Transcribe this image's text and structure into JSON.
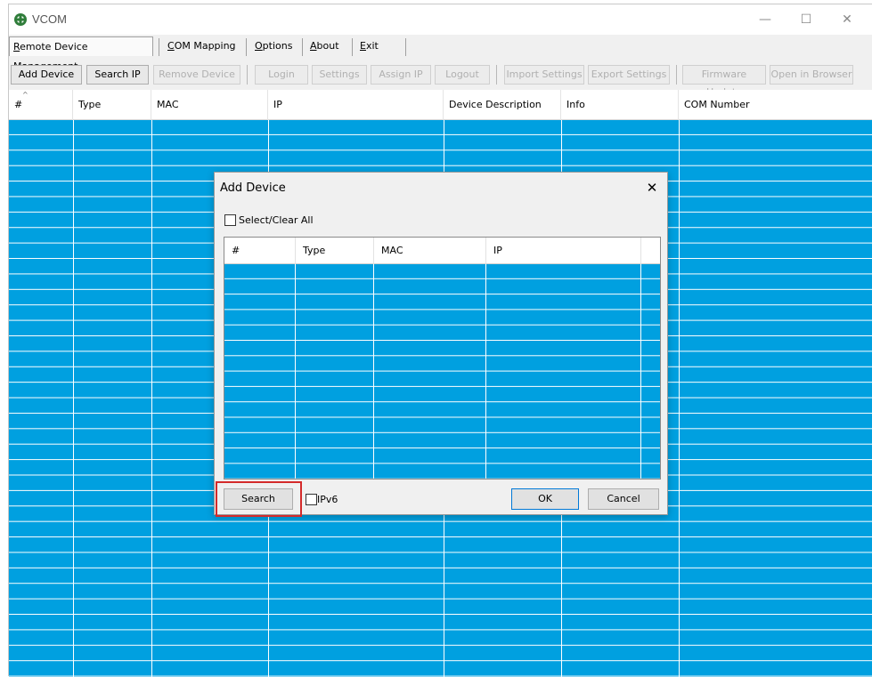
{
  "window": {
    "title": "VCOM",
    "controls": {
      "minimize": "—",
      "maximize": "☐",
      "close": "✕"
    }
  },
  "menu": {
    "items": [
      {
        "label_pre": "",
        "label_u": "R",
        "label_post": "emote Device Management"
      },
      {
        "label_pre": "",
        "label_u": "C",
        "label_post": "OM Mapping"
      },
      {
        "label_pre": "",
        "label_u": "O",
        "label_post": "ptions"
      },
      {
        "label_pre": "",
        "label_u": "A",
        "label_post": "bout"
      },
      {
        "label_pre": "",
        "label_u": "E",
        "label_post": "xit"
      }
    ]
  },
  "toolbar": {
    "buttons": [
      {
        "label": "Add Device",
        "enabled": true
      },
      {
        "label": "Search IP",
        "enabled": true
      },
      {
        "label": "Remove Device",
        "enabled": false
      },
      {
        "label": "Login",
        "enabled": false
      },
      {
        "label": "Settings",
        "enabled": false
      },
      {
        "label": "Assign IP",
        "enabled": false
      },
      {
        "label": "Logout",
        "enabled": false
      },
      {
        "label": "Import Settings",
        "enabled": false
      },
      {
        "label": "Export Settings",
        "enabled": false
      },
      {
        "label": "Firmware Update",
        "enabled": false
      },
      {
        "label": "Open in Browser",
        "enabled": false
      }
    ]
  },
  "grid": {
    "columns": [
      "#",
      "Type",
      "MAC",
      "IP",
      "Device Description",
      "Info",
      "COM Number"
    ],
    "sort_indicator": "^",
    "row_color": "#00a0e0"
  },
  "dialog": {
    "title": "Add Device",
    "close": "✕",
    "select_all_label": "Select/Clear All",
    "columns": [
      "#",
      "Type",
      "MAC",
      "IP"
    ],
    "search_button": "Search",
    "ipv6_label": "IPv6",
    "ok_button": "OK",
    "cancel_button": "Cancel"
  },
  "colors": {
    "selection_blue": "#00a0e0",
    "highlight_red": "#d42a2a",
    "focus_blue": "#0078d7"
  }
}
